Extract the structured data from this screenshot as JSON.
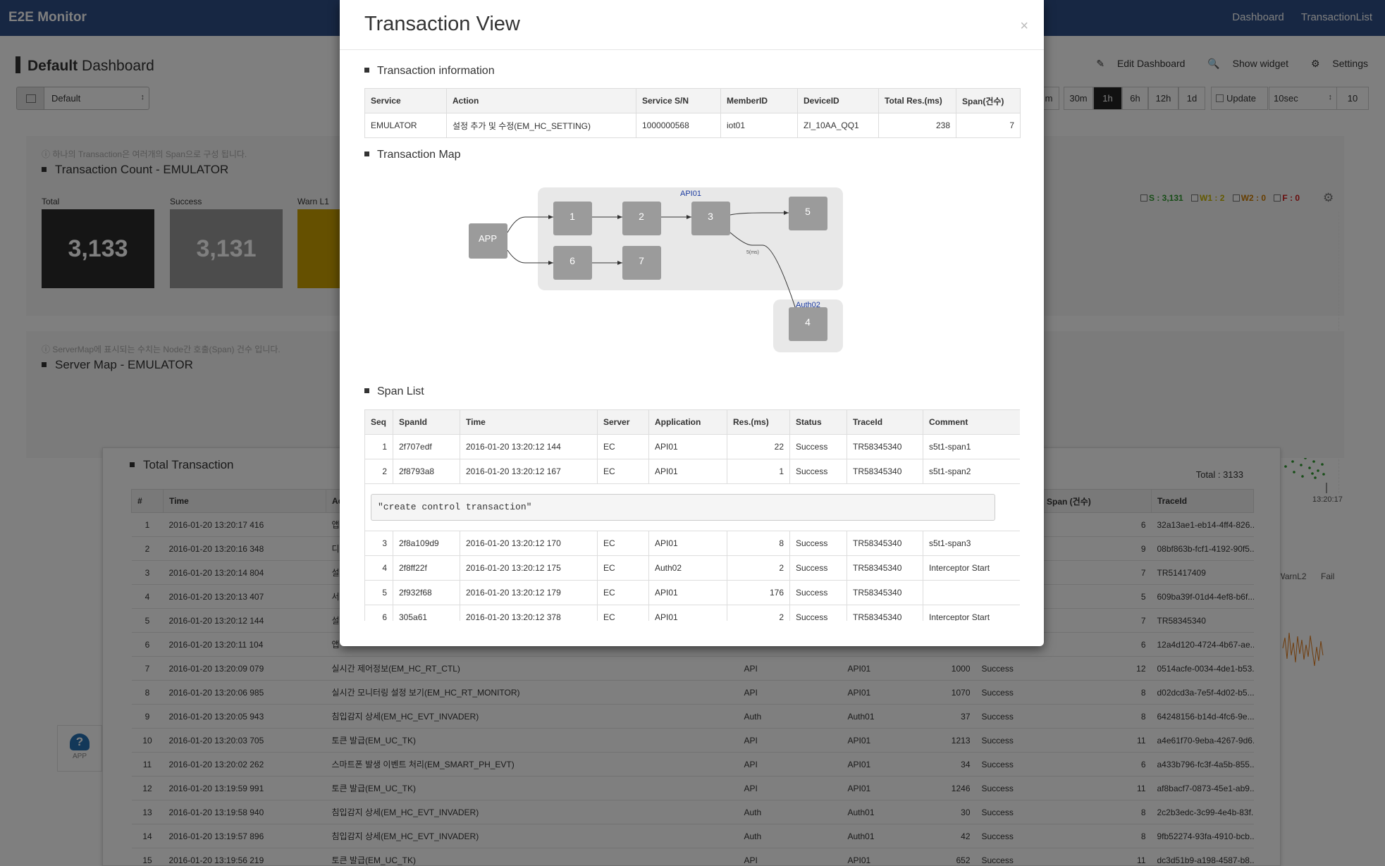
{
  "app": {
    "brand": "E2E Monitor",
    "nav": [
      "Dashboard",
      "TransactionList"
    ]
  },
  "dashboard": {
    "title_bold": "Default",
    "title_rest": " Dashboard",
    "actions": {
      "edit": "Edit Dashboard",
      "show_widget": "Show widget",
      "settings": "Settings"
    },
    "layout_select": "Default",
    "time_buttons": [
      "m",
      "30m",
      "1h",
      "6h",
      "12h",
      "1d"
    ],
    "active_time": "1h",
    "update_label": "Update",
    "interval": "10sec",
    "count": "10"
  },
  "count_panel": {
    "note": "하나의 Transaction은 여러개의 Span으로 구성 됩니다.",
    "title": "Transaction Count - EMULATOR",
    "cards": [
      {
        "label": "Total",
        "value": "3,133",
        "color": "#2b2b2b"
      },
      {
        "label": "Success",
        "value": "3,131",
        "color": "#999999"
      },
      {
        "label": "Warn L1",
        "value": "",
        "color": "#caa000"
      }
    ],
    "legend": [
      {
        "label": "S : 3,131",
        "color": "#2e9a2e"
      },
      {
        "label": "W1 : 2",
        "color": "#c9b400"
      },
      {
        "label": "W2 : 0",
        "color": "#cf7d00"
      },
      {
        "label": "F : 0",
        "color": "#d01818"
      }
    ],
    "time_label": "13:20:17",
    "mini_legend": [
      "WarnL2",
      "Fail"
    ]
  },
  "server_map_panel": {
    "note": "ServerMap에 표시되는 수치는 Node간 호출(Span) 건수 입니다.",
    "title": "Server Map - EMULATOR",
    "app_label": "APP"
  },
  "total_transaction": {
    "title": "Total Transaction",
    "total": "Total : 3133",
    "columns": [
      "#",
      "Time",
      "Ac",
      "",
      "",
      "",
      "",
      "Span (건수)",
      "TraceId"
    ],
    "rows": [
      [
        "1",
        "2016-01-20 13:20:17 416",
        "앱",
        "",
        "",
        "",
        "",
        "6",
        "32a13ae1-eb14-4ff4-826..."
      ],
      [
        "2",
        "2016-01-20 13:20:16 348",
        "디",
        "",
        "",
        "",
        "",
        "9",
        "08bf863b-fcf1-4192-90f5..."
      ],
      [
        "3",
        "2016-01-20 13:20:14 804",
        "설",
        "",
        "",
        "",
        "",
        "7",
        "TR51417409"
      ],
      [
        "4",
        "2016-01-20 13:20:13 407",
        "서",
        "",
        "",
        "",
        "",
        "5",
        "609ba39f-01d4-4ef8-b6f..."
      ],
      [
        "5",
        "2016-01-20 13:20:12 144",
        "설",
        "",
        "",
        "",
        "",
        "7",
        "TR58345340"
      ],
      [
        "6",
        "2016-01-20 13:20:11 104",
        "앱",
        "",
        "",
        "",
        "",
        "6",
        "12a4d120-4724-4b67-ae..."
      ],
      [
        "7",
        "2016-01-20 13:20:09 079",
        "실시간 제어정보(EM_HC_RT_CTL)",
        "API",
        "API01",
        "1000",
        "Success",
        "12",
        "0514acfe-0034-4de1-b53..."
      ],
      [
        "8",
        "2016-01-20 13:20:06 985",
        "실시간 모니터링 설정 보기(EM_HC_RT_MONITOR)",
        "API",
        "API01",
        "1070",
        "Success",
        "8",
        "d02dcd3a-7e5f-4d02-b5..."
      ],
      [
        "9",
        "2016-01-20 13:20:05 943",
        "침입감지 상세(EM_HC_EVT_INVADER)",
        "Auth",
        "Auth01",
        "37",
        "Success",
        "8",
        "64248156-b14d-4fc6-9e..."
      ],
      [
        "10",
        "2016-01-20 13:20:03 705",
        "토큰 발급(EM_UC_TK)",
        "API",
        "API01",
        "1213",
        "Success",
        "11",
        "a4e61f70-9eba-4267-9d6..."
      ],
      [
        "11",
        "2016-01-20 13:20:02 262",
        "스마트폰 발생 이벤트 처리(EM_SMART_PH_EVT)",
        "API",
        "API01",
        "34",
        "Success",
        "6",
        "a433b796-fc3f-4a5b-855..."
      ],
      [
        "12",
        "2016-01-20 13:19:59 991",
        "토큰 발급(EM_UC_TK)",
        "API",
        "API01",
        "1246",
        "Success",
        "11",
        "af8bacf7-0873-45e1-ab9..."
      ],
      [
        "13",
        "2016-01-20 13:19:58 940",
        "침입감지 상세(EM_HC_EVT_INVADER)",
        "Auth",
        "Auth01",
        "30",
        "Success",
        "8",
        "2c2b3edc-3c99-4e4b-83f..."
      ],
      [
        "14",
        "2016-01-20 13:19:57 896",
        "침입감지 상세(EM_HC_EVT_INVADER)",
        "Auth",
        "Auth01",
        "42",
        "Success",
        "8",
        "9fb52274-93fa-4910-bcb..."
      ],
      [
        "15",
        "2016-01-20 13:19:56 219",
        "토큰 발급(EM_UC_TK)",
        "API",
        "API01",
        "652",
        "Success",
        "11",
        "dc3d51b9-a198-4587-b8..."
      ]
    ]
  },
  "modal": {
    "title": "Transaction View",
    "close": "×",
    "info_title": "Transaction information",
    "info_columns": [
      "Service",
      "Action",
      "Service S/N",
      "MemberID",
      "DeviceID",
      "Total Res.(ms)",
      "Span(건수)"
    ],
    "info_row": [
      "EMULATOR",
      "설정 추가 및 수정(EM_HC_SETTING)",
      "1000000568",
      "iot01",
      "ZI_10AA_QQ1",
      "238",
      "7"
    ],
    "map_title": "Transaction Map",
    "map": {
      "group_labels": [
        "API01",
        "Auth02"
      ],
      "app_label": "APP",
      "nodes": [
        "1",
        "2",
        "3",
        "5",
        "6",
        "7",
        "4"
      ],
      "edge_label": "5(ms)"
    },
    "span_title": "Span List",
    "span_columns": [
      "Seq",
      "SpanId",
      "Time",
      "Server",
      "Application",
      "Res.(ms)",
      "Status",
      "TraceId",
      "Comment"
    ],
    "spans_a": [
      [
        "1",
        "2f707edf",
        "2016-01-20 13:20:12 144",
        "EC",
        "API01",
        "22",
        "Success",
        "TR58345340",
        "s5t1-span1"
      ],
      [
        "2",
        "2f8793a8",
        "2016-01-20 13:20:12 167",
        "EC",
        "API01",
        "1",
        "Success",
        "TR58345340",
        "s5t1-span2"
      ]
    ],
    "detail": "\"create control transaction\"",
    "spans_b": [
      [
        "3",
        "2f8a109d9",
        "2016-01-20 13:20:12 170",
        "EC",
        "API01",
        "8",
        "Success",
        "TR58345340",
        "s5t1-span3"
      ],
      [
        "4",
        "2f8ff22f",
        "2016-01-20 13:20:12 175",
        "EC",
        "Auth02",
        "2",
        "Success",
        "TR58345340",
        "Interceptor Start"
      ],
      [
        "5",
        "2f932f68",
        "2016-01-20 13:20:12 179",
        "EC",
        "API01",
        "176",
        "Success",
        "TR58345340",
        ""
      ],
      [
        "6",
        "305a61",
        "2016-01-20 13:20:12 378",
        "EC",
        "API01",
        "2",
        "Success",
        "TR58345340",
        "Interceptor Start"
      ]
    ]
  }
}
